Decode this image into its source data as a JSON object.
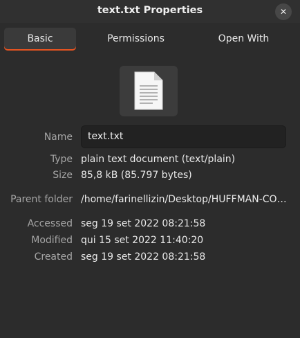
{
  "window": {
    "title": "text.txt Properties",
    "close_icon": "close-icon"
  },
  "tabs": [
    {
      "label": "Basic",
      "active": true
    },
    {
      "label": "Permissions",
      "active": false
    },
    {
      "label": "Open With",
      "active": false
    }
  ],
  "file_icon": "text-document-icon",
  "fields": {
    "name": {
      "label": "Name",
      "value": "text.txt"
    },
    "type": {
      "label": "Type",
      "value": "plain text document (text/plain)"
    },
    "size": {
      "label": "Size",
      "value": "85,8 kB (85.797 bytes)"
    },
    "parent": {
      "label": "Parent folder",
      "value": "/home/farinellizin/Desktop/HUFFMAN-CO…"
    },
    "accessed": {
      "label": "Accessed",
      "value": "seg 19 set 2022 08:21:58"
    },
    "modified": {
      "label": "Modified",
      "value": "qui 15 set 2022 11:40:20"
    },
    "created": {
      "label": "Created",
      "value": "seg 19 set 2022 08:21:58"
    }
  },
  "colors": {
    "accent": "#e95420",
    "background": "#2c2c2c"
  }
}
